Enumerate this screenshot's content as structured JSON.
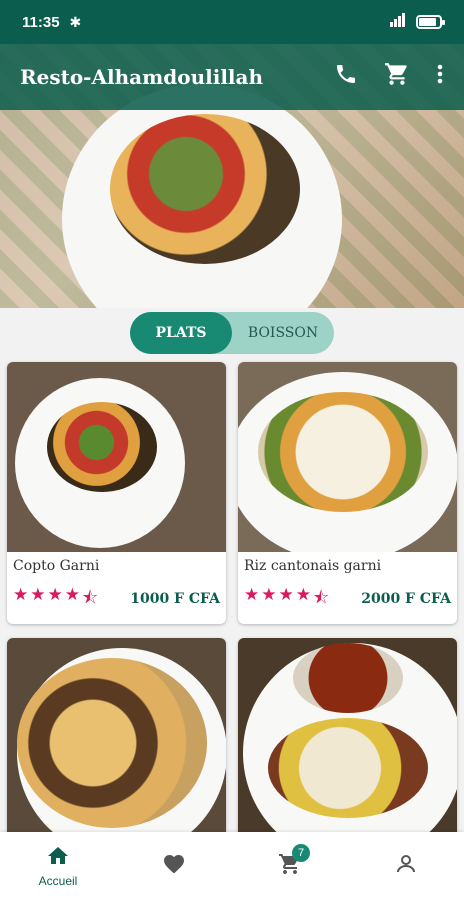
{
  "status_bar": {
    "time": "11:35",
    "battery_level": 0.85
  },
  "app": {
    "title": "Resto-Alhamdoulillah"
  },
  "icons": {
    "phone": "phone-icon",
    "cart": "cart-icon",
    "more": "more-vert-icon",
    "home": "home-icon",
    "favorite": "heart-icon",
    "profile": "person-icon"
  },
  "carousel": {
    "slide_count": 14,
    "active_index": 0
  },
  "tabs": [
    {
      "label": "PLATS",
      "active": true
    },
    {
      "label": "BOISSON",
      "active": false
    }
  ],
  "items": [
    {
      "name": "Copto Garni",
      "price": "1000 F CFA",
      "rating": 4.5
    },
    {
      "name": "Riz cantonais garni",
      "price": "2000 F CFA",
      "rating": 4.5
    },
    {
      "name": "",
      "price": "",
      "rating": 0
    },
    {
      "name": "",
      "price": "",
      "rating": 0
    }
  ],
  "bottom_nav": {
    "home_label": "Accueil",
    "cart_badge": "7"
  },
  "colors": {
    "primary": "#0b5d4d",
    "accent": "#188a74",
    "star": "#d81b60"
  }
}
